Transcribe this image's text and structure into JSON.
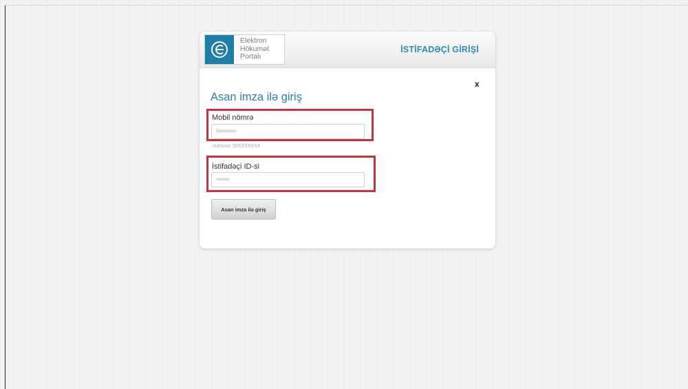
{
  "header": {
    "logo_lines": [
      "Elektron",
      "Hökumət",
      "Portalı"
    ],
    "title": "İSTİFADƏÇİ GİRİŞİ"
  },
  "dialog": {
    "close_label": "x",
    "title": "Asan imza ilə giriş",
    "mobile": {
      "label": "Mobil nömrə",
      "value": "5•••••••••",
      "hint": "nümunə: 50XXXXXXX"
    },
    "user_id": {
      "label": "İstifadəçi ID-si",
      "value": "•••••••"
    },
    "submit_label": "Asan imza ilə giriş"
  },
  "colors": {
    "brand": "#1d7ea7",
    "title": "#2d7fb2",
    "highlight": "#c8323a"
  }
}
